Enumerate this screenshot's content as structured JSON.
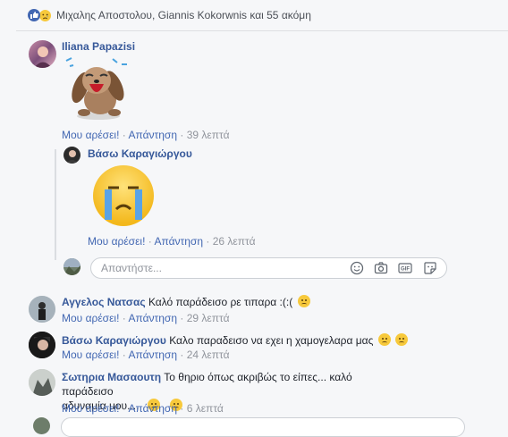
{
  "reactions": {
    "names": "Μιχαλης Αποστολου, Giannis Kokorwnis και 55 ακόμη",
    "icons": [
      "like-icon",
      "sad-icon"
    ]
  },
  "comments": [
    {
      "author": "Iliana Papazisi",
      "sticker": "crying-dog-sticker",
      "like_label": "Μου αρέσει!",
      "reply_label": "Απάντηση",
      "time": "39 λεπτά",
      "replies": [
        {
          "author": "Βάσω Καραγιώργου",
          "sticker": "crying-face-sticker",
          "like_label": "Μου αρέσει!",
          "reply_label": "Απάντηση",
          "time": "26 λεπτά"
        }
      ]
    },
    {
      "author": "Αγγελος Νατσας",
      "text": "Καλό παράδεισο ρε τιπαρα :(:(",
      "like_label": "Μου αρέσει!",
      "reply_label": "Απάντηση",
      "time": "29 λεπτά"
    },
    {
      "author": "Βάσω Καραγιώργου",
      "text": "Καλο παραδεισο να εχει η χαμογελαρα μας",
      "like_label": "Μου αρέσει!",
      "reply_label": "Απάντηση",
      "time": "24 λεπτά"
    },
    {
      "author": "Σωτηρια Μασαουτη",
      "text_line1": "Το θηριο όπως ακριβώς το είπες... καλό παράδεισο",
      "text_line2": "αδυναμία μου....",
      "like_label": "Μου αρέσει!",
      "reply_label": "Απάντηση",
      "time": "6 λεπτά"
    }
  ],
  "reply_box": {
    "placeholder": "Απαντήστε...",
    "icons": [
      "emoji-icon",
      "camera-icon",
      "gif-icon",
      "sticker-icon"
    ]
  },
  "colors": {
    "link": "#365899",
    "action": "#4267b2",
    "meta": "#90949c",
    "background": "#f6f7f9"
  }
}
